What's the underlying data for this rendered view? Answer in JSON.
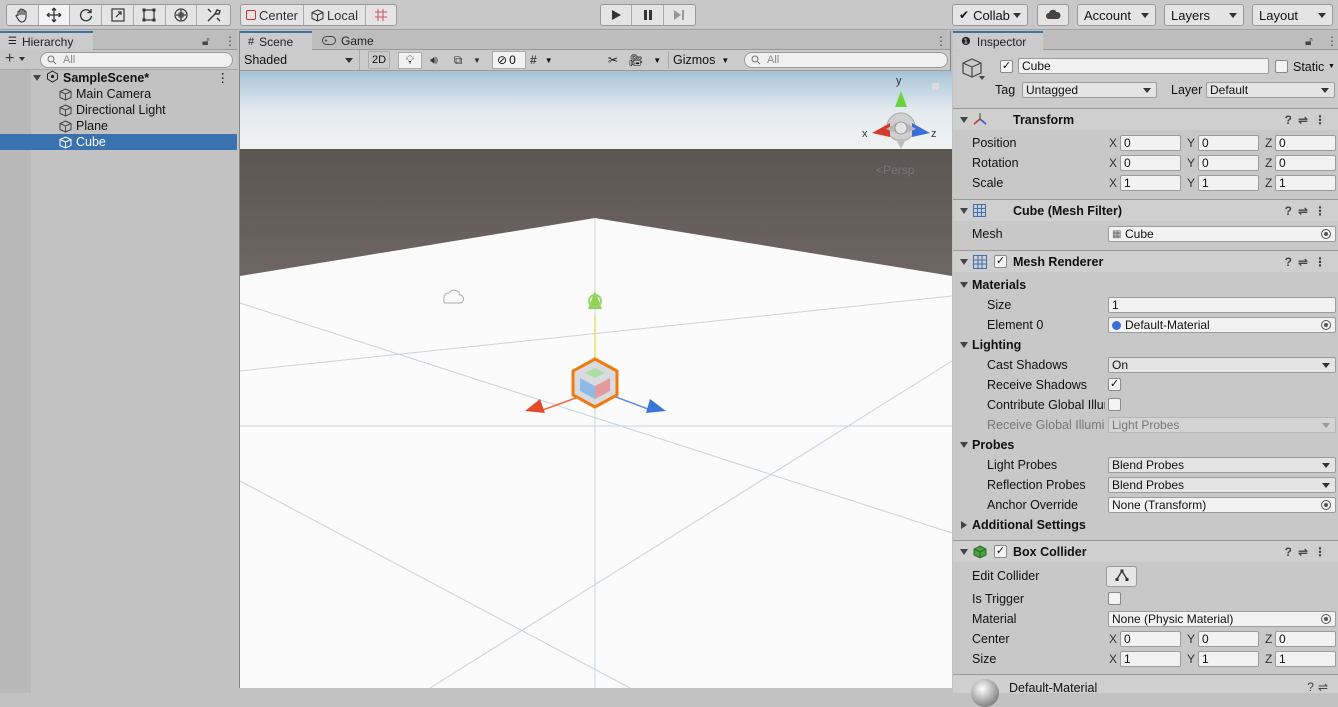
{
  "toolbar": {
    "tools": [
      "hand-tool",
      "move-tool",
      "rotate-tool",
      "scale-tool",
      "rect-tool",
      "transform-tool",
      "custom-tool"
    ],
    "pivot": "Center",
    "space": "Local",
    "collab": "Collab",
    "account": "Account",
    "layers": "Layers",
    "layout": "Layout"
  },
  "hierarchy": {
    "tab": "Hierarchy",
    "search_placeholder": "All",
    "scene": "SampleScene*",
    "items": [
      "Main Camera",
      "Directional Light",
      "Plane",
      "Cube"
    ],
    "selected": "Cube"
  },
  "scene": {
    "tab_scene": "Scene",
    "tab_game": "Game",
    "shading": "Shaded",
    "mode_2d": "2D",
    "hidden_count": "0",
    "gizmos": "Gizmos",
    "search_placeholder": "All",
    "persp": "Persp",
    "axis_y": "y",
    "axis_x": "x",
    "axis_z": "z"
  },
  "inspector": {
    "tab": "Inspector",
    "object_name": "Cube",
    "static_label": "Static",
    "tag_label": "Tag",
    "tag_value": "Untagged",
    "layer_label": "Layer",
    "layer_value": "Default",
    "transform": {
      "title": "Transform",
      "position_label": "Position",
      "rotation_label": "Rotation",
      "scale_label": "Scale",
      "position": [
        "0",
        "0",
        "0"
      ],
      "rotation": [
        "0",
        "0",
        "0"
      ],
      "scale": [
        "1",
        "1",
        "1"
      ]
    },
    "mesh_filter": {
      "title": "Cube (Mesh Filter)",
      "mesh_label": "Mesh",
      "mesh_value": "Cube"
    },
    "mesh_renderer": {
      "title": "Mesh Renderer",
      "materials": "Materials",
      "size_label": "Size",
      "size_value": "1",
      "element0_label": "Element 0",
      "element0_value": "Default-Material",
      "lighting": "Lighting",
      "cast_shadows_label": "Cast Shadows",
      "cast_shadows_value": "On",
      "receive_shadows_label": "Receive Shadows",
      "contribute_gi_label": "Contribute Global Illur",
      "receive_gi_label": "Receive Global Illumi",
      "receive_gi_value": "Light Probes",
      "probes": "Probes",
      "light_probes_label": "Light Probes",
      "light_probes_value": "Blend Probes",
      "reflection_probes_label": "Reflection Probes",
      "reflection_probes_value": "Blend Probes",
      "anchor_override_label": "Anchor Override",
      "anchor_override_value": "None (Transform)",
      "additional_settings": "Additional Settings"
    },
    "box_collider": {
      "title": "Box Collider",
      "edit_collider_label": "Edit Collider",
      "is_trigger_label": "Is Trigger",
      "material_label": "Material",
      "material_value": "None (Physic Material)",
      "center_label": "Center",
      "size_label": "Size",
      "center": [
        "0",
        "0",
        "0"
      ],
      "size": [
        "1",
        "1",
        "1"
      ]
    },
    "material_footer": "Default-Material"
  }
}
